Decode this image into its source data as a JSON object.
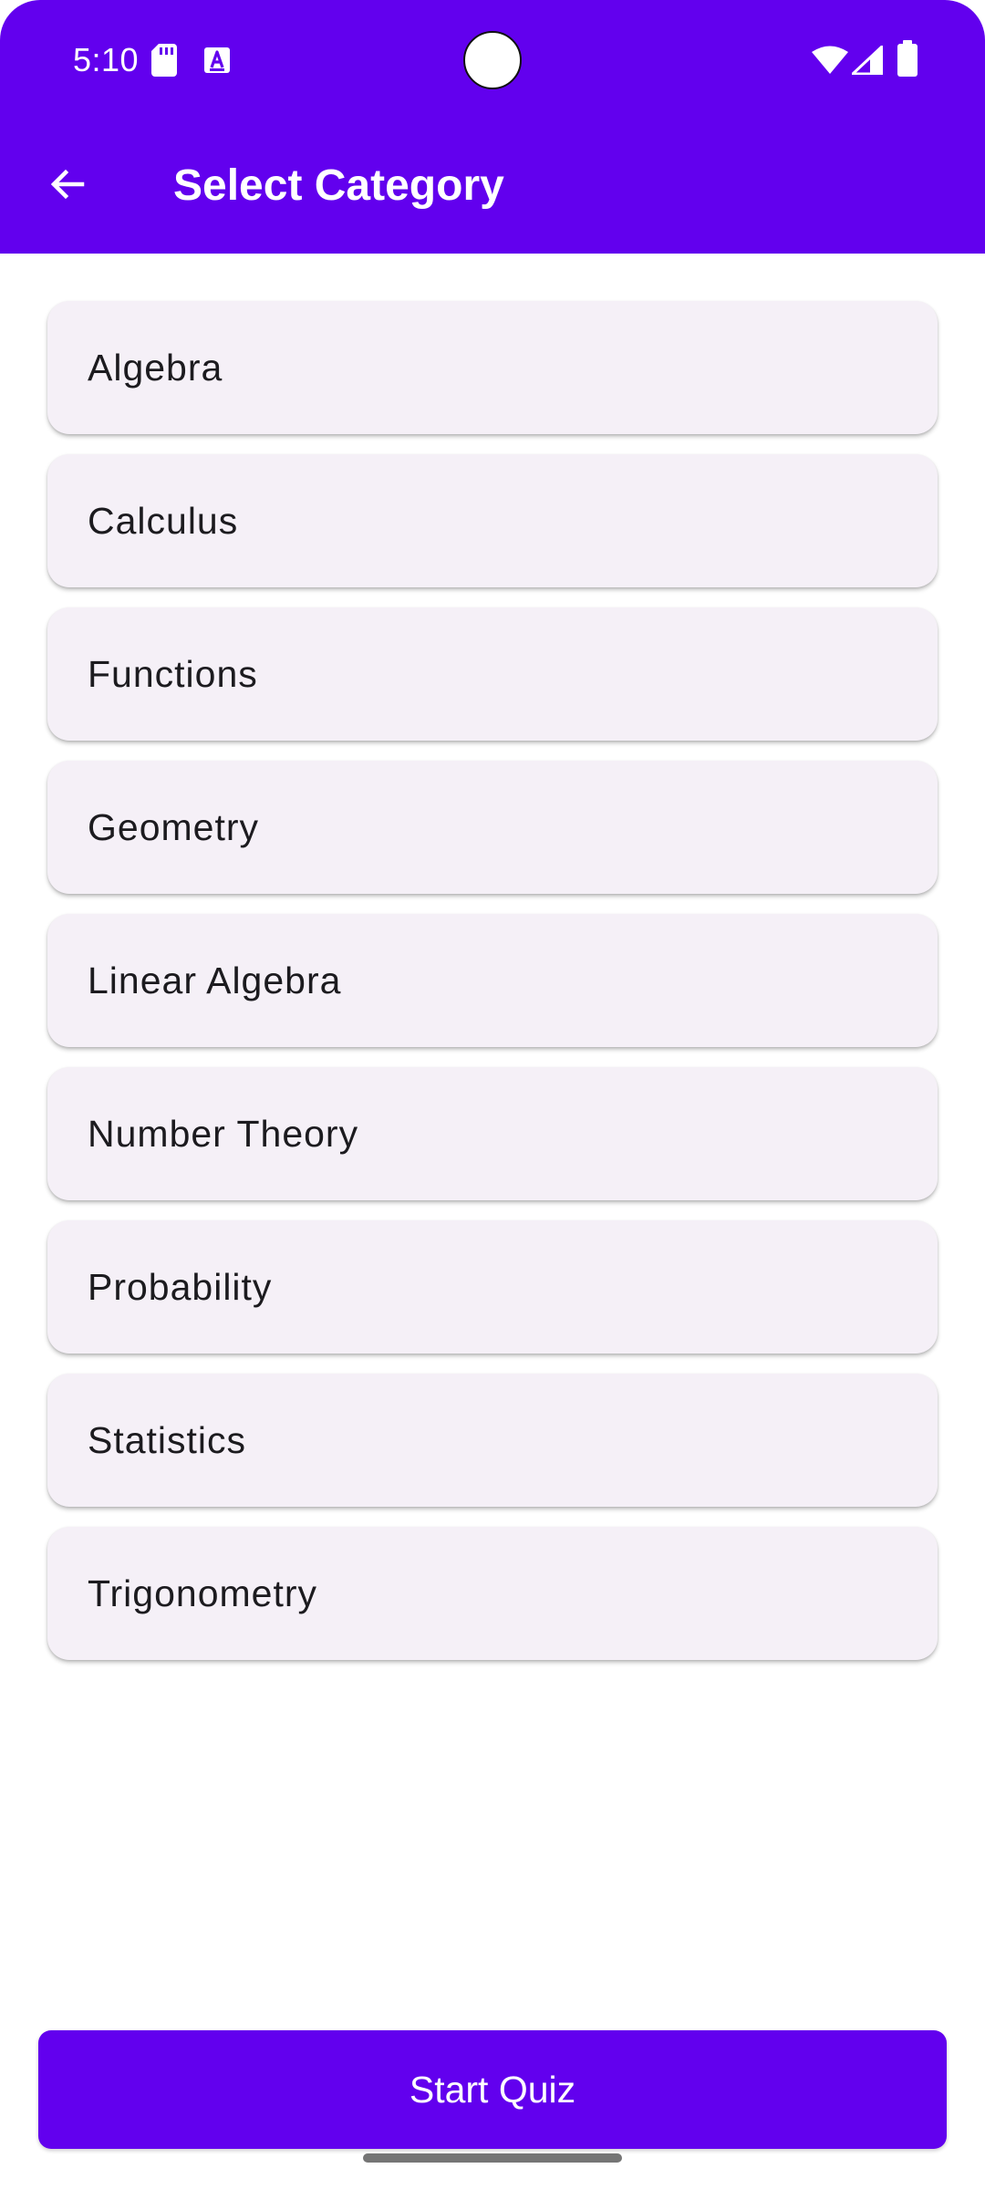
{
  "status_bar": {
    "time": "5:10",
    "icons": [
      "sd-card-icon",
      "font-a-icon",
      "wifi-icon",
      "signal-icon",
      "battery-icon"
    ]
  },
  "app_bar": {
    "title": "Select Category",
    "back_icon": "arrow-back-icon"
  },
  "categories": [
    {
      "label": "Algebra"
    },
    {
      "label": "Calculus"
    },
    {
      "label": "Functions"
    },
    {
      "label": "Geometry"
    },
    {
      "label": "Linear Algebra"
    },
    {
      "label": "Number Theory"
    },
    {
      "label": "Probability"
    },
    {
      "label": "Statistics"
    },
    {
      "label": "Trigonometry"
    }
  ],
  "start_button": {
    "label": "Start Quiz"
  },
  "colors": {
    "primary": "#6200EE",
    "card_background": "#F5F0F7",
    "text_primary": "#1C1B1F",
    "on_primary": "#FFFFFF"
  }
}
